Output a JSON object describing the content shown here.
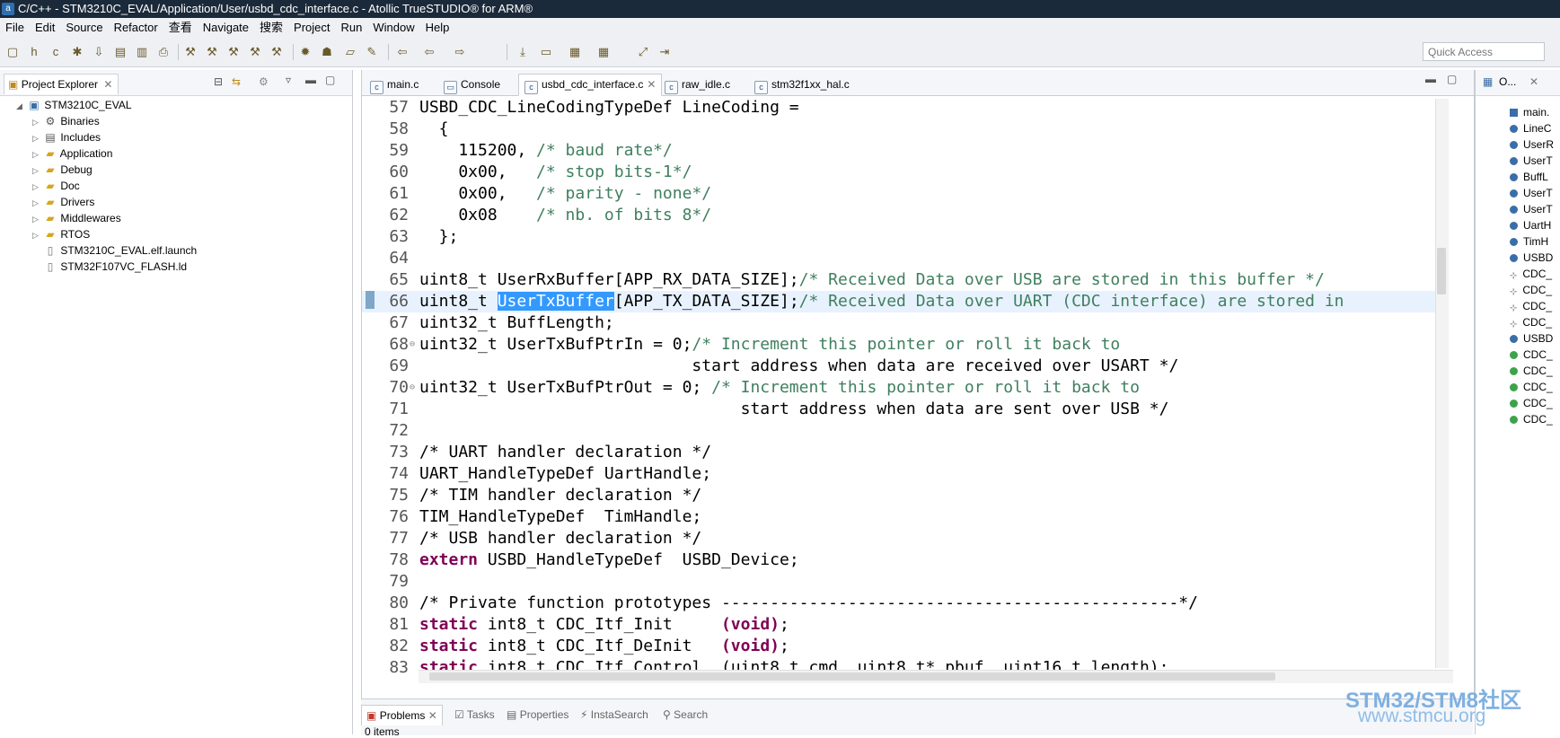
{
  "window": {
    "title": "C/C++ - STM3210C_EVAL/Application/User/usbd_cdc_interface.c - Atollic TrueSTUDIO® for ARM®"
  },
  "menu": [
    "File",
    "Edit",
    "Source",
    "Refactor",
    "查看",
    "Navigate",
    "搜索",
    "Project",
    "Run",
    "Window",
    "Help"
  ],
  "quick_access": {
    "placeholder": "Quick Access"
  },
  "project_explorer": {
    "title": "Project Explorer",
    "root": "STM3210C_EVAL",
    "items": [
      "Binaries",
      "Includes",
      "Application",
      "Debug",
      "Doc",
      "Drivers",
      "Middlewares",
      "RTOS"
    ],
    "files": [
      "STM3210C_EVAL.elf.launch",
      "STM32F107VC_FLASH.ld"
    ]
  },
  "editor": {
    "tabs": [
      {
        "label": "main.c",
        "icon": "c-file-icon"
      },
      {
        "label": "Console",
        "icon": "console-icon"
      },
      {
        "label": "usbd_cdc_interface.c",
        "icon": "c-file-icon",
        "active": true
      },
      {
        "label": "raw_idle.c",
        "icon": "c-file-icon"
      },
      {
        "label": "stm32f1xx_hal.c",
        "icon": "c-file-icon"
      }
    ],
    "lines": {
      "n57": "57",
      "n58": "58",
      "n59": "59",
      "n60": "60",
      "n61": "61",
      "n62": "62",
      "n63": "63",
      "n64": "64",
      "n65": "65",
      "n66": "66",
      "n67": "67",
      "n68": "68",
      "n69": "69",
      "n70": "70",
      "n71": "71",
      "n72": "72",
      "n73": "73",
      "n74": "74",
      "n75": "75",
      "n76": "76",
      "n77": "77",
      "n78": "78",
      "n79": "79",
      "n80": "80",
      "n81": "81",
      "n82": "82",
      "n83": "83",
      "l57": "USBD_CDC_LineCodingTypeDef LineCoding =",
      "l58": "  {",
      "l59a": "    115200, ",
      "l59b": "/* baud rate*/",
      "l60a": "    0x00,   ",
      "l60b": "/* stop bits-1*/",
      "l61a": "    0x00,   ",
      "l61b": "/* parity - none*/",
      "l62a": "    0x08    ",
      "l62b": "/* nb. of bits 8*/",
      "l63": "  };",
      "l65a": "uint8_t UserRxBuffer[APP_RX_DATA_SIZE];",
      "l65b": "/* Received Data over USB are stored in this buffer */",
      "l66a": "uint8_t ",
      "l66sel": "UserTxBuffer",
      "l66b": "[APP_TX_DATA_SIZE];",
      "l66c": "/* Received Data over UART (CDC interface) are stored in",
      "l67": "uint32_t BuffLength;",
      "l68a": "uint32_t UserTxBufPtrIn = 0;",
      "l68b": "/* Increment this pointer or roll it back to",
      "l69": "                            start address when data are received over USART */",
      "l70a": "uint32_t UserTxBufPtrOut = 0; ",
      "l70b": "/* Increment this pointer or roll it back to",
      "l71": "                                 start address when data are sent over USB */",
      "l73": "/* UART handler declaration */",
      "l74": "UART_HandleTypeDef UartHandle;",
      "l75": "/* TIM handler declaration */",
      "l76": "TIM_HandleTypeDef  TimHandle;",
      "l77": "/* USB handler declaration */",
      "l78k": "extern",
      "l78b": " USBD_HandleTypeDef  USBD_Device;",
      "l80": "/* Private function prototypes -----------------------------------------------*/",
      "static": "static",
      "void": "(void)",
      "l81a": " int8_t CDC_Itf_Init     ",
      "l81b": ";",
      "l82a": " int8_t CDC_Itf_DeInit   ",
      "l82b": ";",
      "l83a": " int8_t CDC_Itf_Control  (uint8_t cmd, uint8_t* pbuf, uint16_t length);"
    }
  },
  "outline": {
    "title": "O...",
    "items": [
      "main.",
      "LineC",
      "UserR",
      "UserT",
      "BuffL",
      "UserT",
      "UserT",
      "UartH",
      "TimH",
      "USBD",
      "CDC_",
      "CDC_",
      "CDC_",
      "CDC_",
      "USBD",
      "CDC_",
      "CDC_",
      "CDC_",
      "CDC_",
      "CDC_"
    ]
  },
  "bottom_panel": {
    "tabs": [
      "Problems",
      "Tasks",
      "Properties",
      "InstaSearch",
      "Search"
    ],
    "status": "0 items"
  },
  "watermark": {
    "line1": "STM32/STM8社区",
    "line2": "www.stmcu.org"
  }
}
